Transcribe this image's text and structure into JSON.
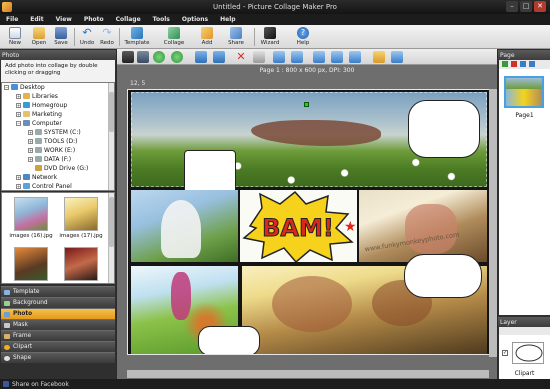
{
  "window": {
    "title": "Untitled - Picture Collage Maker Pro"
  },
  "menu": [
    "File",
    "Edit",
    "View",
    "Photo",
    "Collage",
    "Tools",
    "Options",
    "Help"
  ],
  "toolbar": {
    "new": "New",
    "open": "Open",
    "save": "Save",
    "undo": "Undo",
    "redo": "Redo",
    "template": "Template",
    "collage": "Collage",
    "add": "Add",
    "share": "Share",
    "wizard": "Wizard",
    "help": "Help"
  },
  "photo_panel": {
    "header": "Photo",
    "hint": "Add photo into collage by double clicking or dragging",
    "tree": [
      "Desktop",
      "Libraries",
      "Homegroup",
      "Marketing",
      "Computer",
      "SYSTEM (C:)",
      "TOOLS (D:)",
      "WORK (E:)",
      "DATA (F:)",
      "DVD Drive (G:)",
      "Network",
      "Control Panel"
    ],
    "thumbs": [
      "images (16).jpg",
      "images (17).jpg"
    ]
  },
  "left_tabs": [
    "Template",
    "Background",
    "Photo",
    "Mask",
    "Frame",
    "Clipart",
    "Shape"
  ],
  "canvas": {
    "page_info": "Page 1 : 800 x 600 px, DPI: 300",
    "ruler": "12, 5",
    "callout_text": "BAM!",
    "watermark": "www.funkymonkeyphoto.com"
  },
  "page_panel": {
    "header": "Page",
    "page_label": "Page1"
  },
  "layer_panel": {
    "header": "Layer",
    "layer_label": "Clipart"
  },
  "status": {
    "share": "Share on Facebook"
  },
  "colors": {
    "active_tab": "#e49a1c",
    "bam_yellow": "#f7d21c",
    "bam_red": "#d62a1c",
    "selection_blue": "#4aa1e0"
  }
}
